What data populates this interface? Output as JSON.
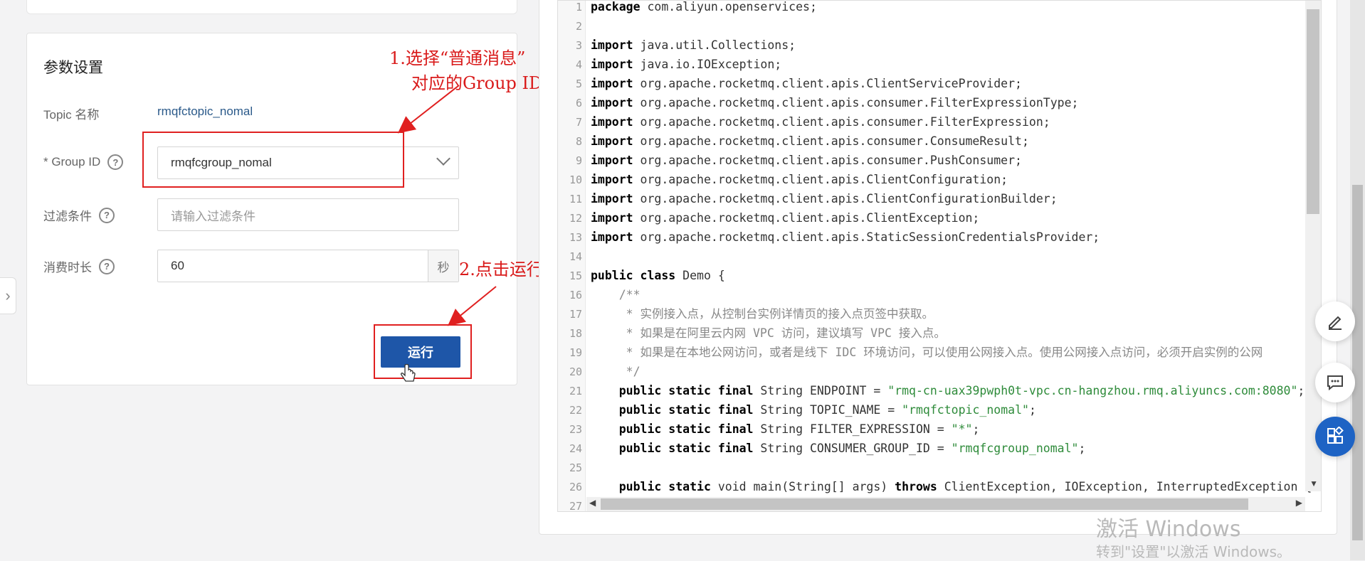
{
  "settings": {
    "title": "参数设置",
    "topic_label": "Topic 名称",
    "topic_value": "rmqfctopic_nomal",
    "group_label": "* Group ID",
    "group_value": "rmqfcgroup_nomal",
    "filter_label": "过滤条件",
    "filter_placeholder": "请输入过滤条件",
    "duration_label": "消费时长",
    "duration_value": "60",
    "duration_unit": "秒",
    "run_label": "运行"
  },
  "annotations": {
    "step1_line1": "1.选择“普通消息”",
    "step1_line2": "对应的Group ID",
    "step2": "2.点击运行"
  },
  "editor": {
    "lines": [
      [
        {
          "t": "package",
          "c": "kw"
        },
        {
          "t": " com.aliyun.openservices;"
        }
      ],
      [],
      [
        {
          "t": "import",
          "c": "kw"
        },
        {
          "t": " java.util.Collections;"
        }
      ],
      [
        {
          "t": "import",
          "c": "kw"
        },
        {
          "t": " java.io.IOException;"
        }
      ],
      [
        {
          "t": "import",
          "c": "kw"
        },
        {
          "t": " org.apache.rocketmq.client.apis.ClientServiceProvider;"
        }
      ],
      [
        {
          "t": "import",
          "c": "kw"
        },
        {
          "t": " org.apache.rocketmq.client.apis.consumer.FilterExpressionType;"
        }
      ],
      [
        {
          "t": "import",
          "c": "kw"
        },
        {
          "t": " org.apache.rocketmq.client.apis.consumer.FilterExpression;"
        }
      ],
      [
        {
          "t": "import",
          "c": "kw"
        },
        {
          "t": " org.apache.rocketmq.client.apis.consumer.ConsumeResult;"
        }
      ],
      [
        {
          "t": "import",
          "c": "kw"
        },
        {
          "t": " org.apache.rocketmq.client.apis.consumer.PushConsumer;"
        }
      ],
      [
        {
          "t": "import",
          "c": "kw"
        },
        {
          "t": " org.apache.rocketmq.client.apis.ClientConfiguration;"
        }
      ],
      [
        {
          "t": "import",
          "c": "kw"
        },
        {
          "t": " org.apache.rocketmq.client.apis.ClientConfigurationBuilder;"
        }
      ],
      [
        {
          "t": "import",
          "c": "kw"
        },
        {
          "t": " org.apache.rocketmq.client.apis.ClientException;"
        }
      ],
      [
        {
          "t": "import",
          "c": "kw"
        },
        {
          "t": " org.apache.rocketmq.client.apis.StaticSessionCredentialsProvider;"
        }
      ],
      [],
      [
        {
          "t": "public",
          "c": "kw"
        },
        {
          "t": " "
        },
        {
          "t": "class",
          "c": "kw"
        },
        {
          "t": " Demo {"
        }
      ],
      [
        {
          "t": "    /**",
          "c": "cm"
        }
      ],
      [
        {
          "t": "     * 实例接入点，从控制台实例详情页的接入点页签中获取。",
          "c": "cm"
        }
      ],
      [
        {
          "t": "     * 如果是在阿里云内网 VPC 访问，建议填写 VPC 接入点。",
          "c": "cm"
        }
      ],
      [
        {
          "t": "     * 如果是在本地公网访问，或者是线下 IDC 环境访问，可以使用公网接入点。使用公网接入点访问，必须开启实例的公网",
          "c": "cm"
        }
      ],
      [
        {
          "t": "     */",
          "c": "cm"
        }
      ],
      [
        {
          "t": "    "
        },
        {
          "t": "public static final",
          "c": "kw"
        },
        {
          "t": " String ENDPOINT = "
        },
        {
          "t": "\"rmq-cn-uax39pwph0t-vpc.cn-hangzhou.rmq.aliyuncs.com:8080\"",
          "c": "str"
        },
        {
          "t": ";"
        }
      ],
      [
        {
          "t": "    "
        },
        {
          "t": "public static final",
          "c": "kw"
        },
        {
          "t": " String TOPIC_NAME = "
        },
        {
          "t": "\"rmqfctopic_nomal\"",
          "c": "str"
        },
        {
          "t": ";"
        }
      ],
      [
        {
          "t": "    "
        },
        {
          "t": "public static final",
          "c": "kw"
        },
        {
          "t": " String FILTER_EXPRESSION = "
        },
        {
          "t": "\"*\"",
          "c": "str"
        },
        {
          "t": ";"
        }
      ],
      [
        {
          "t": "    "
        },
        {
          "t": "public static final",
          "c": "kw"
        },
        {
          "t": " String CONSUMER_GROUP_ID = "
        },
        {
          "t": "\"rmqfcgroup_nomal\"",
          "c": "str"
        },
        {
          "t": ";"
        }
      ],
      [],
      [
        {
          "t": "    "
        },
        {
          "t": "public static",
          "c": "kw"
        },
        {
          "t": " void main(String[] args) "
        },
        {
          "t": "throws",
          "c": "kw"
        },
        {
          "t": " ClientException, IOException, InterruptedException {"
        }
      ],
      []
    ]
  },
  "watermark": {
    "line1": "激活 Windows",
    "line2": "转到\"设置\"以激活 Windows。"
  },
  "icons": {
    "edit": "edit-pencil-icon",
    "feedback": "chat-feedback-icon",
    "apps": "apps-grid-icon",
    "collapse": "chevron-right-icon",
    "select": "chevron-down-icon",
    "help": "question-circle-icon",
    "cursor": "hand-pointer-icon"
  },
  "colors": {
    "primary": "#1e56a8",
    "annotation": "#e02020",
    "string": "#2e8b3a"
  }
}
